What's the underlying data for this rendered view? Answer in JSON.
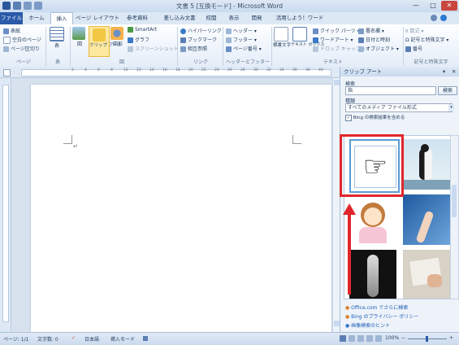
{
  "window": {
    "title": "文書 5 [互換モード] - Microsoft Word",
    "controls": [
      "—",
      "□",
      "✕"
    ]
  },
  "tabs": [
    {
      "label": "ファイル"
    },
    {
      "label": "ホーム"
    },
    {
      "label": "挿入"
    },
    {
      "label": "ページ レイアウト"
    },
    {
      "label": "参考資料"
    },
    {
      "label": "差し込み文書"
    },
    {
      "label": "校閲"
    },
    {
      "label": "表示"
    },
    {
      "label": "開発"
    },
    {
      "label": "活用しよう！ワード"
    }
  ],
  "ribbon": {
    "pages": {
      "items": [
        "表紙",
        "空白のページ",
        "ページ区切り"
      ],
      "label": "ページ"
    },
    "tables": {
      "button": "表",
      "label": "表"
    },
    "illustrations": {
      "picture": "図",
      "clipart": "クリップ アート",
      "shapes": "図形",
      "smartart": "SmartArt",
      "chart": "グラフ",
      "screenshot": "スクリーンショット",
      "label": "図"
    },
    "links": {
      "items": [
        "ハイパーリンク",
        "ブックマーク",
        "相互参照"
      ],
      "label": "リンク"
    },
    "header_footer": {
      "items": [
        "ヘッダー",
        "フッター",
        "ページ番号"
      ],
      "label": "ヘッダーとフッター"
    },
    "text": {
      "textbox": "テキスト ボックス",
      "furigana": "横書文字",
      "quickparts": "クイック パーツ",
      "wordart": "ワードアート",
      "dropcap": "ドロップ キャップ",
      "signature": "署名欄",
      "datetime": "日付と時刻",
      "object": "オブジェクト",
      "label": "テキスト"
    },
    "symbols": {
      "items": [
        "数式",
        "記号と特殊文字",
        "番号"
      ],
      "label": "記号と特殊文字"
    }
  },
  "ruler": {
    "numbers": [
      "2",
      "4",
      "6",
      "8",
      "10",
      "12",
      "14",
      "16",
      "18",
      "20",
      "22",
      "24",
      "26",
      "28",
      "30",
      "32",
      "34",
      "36",
      "38",
      "40"
    ]
  },
  "document": {
    "cursor_mark": "↵"
  },
  "clipart_pane": {
    "title": "クリップ アート",
    "search_label": "検索",
    "search_value": "指",
    "search_button": "検索",
    "type_label": "種類",
    "type_value": "すべてのメディア ファイル形式",
    "bing_checkbox": "Bing の検索結果を含める",
    "bing_checked": true,
    "results": [
      {
        "icon": "pointing-hand-icon",
        "glyph": "☞"
      },
      {
        "icon": "penguin-photo-icon"
      },
      {
        "icon": "girl-thinking-icon"
      },
      {
        "icon": "finger-touch-photo-icon"
      },
      {
        "icon": "foot-xray-icon"
      },
      {
        "icon": "hand-writing-photo-icon"
      }
    ],
    "links": [
      "Office.com でさらに検索",
      "Bing のプライバシー ポリシー",
      "画像検索のヒント"
    ]
  },
  "statusbar": {
    "page": "ページ: 1/1",
    "words": "文字数: 0",
    "language": "日本語",
    "mode": "挿入モード",
    "zoom": "100%",
    "zoom_minus": "−",
    "zoom_plus": "+"
  },
  "colors": {
    "accent": "#2a5aa8",
    "highlight": "#e0262b"
  }
}
